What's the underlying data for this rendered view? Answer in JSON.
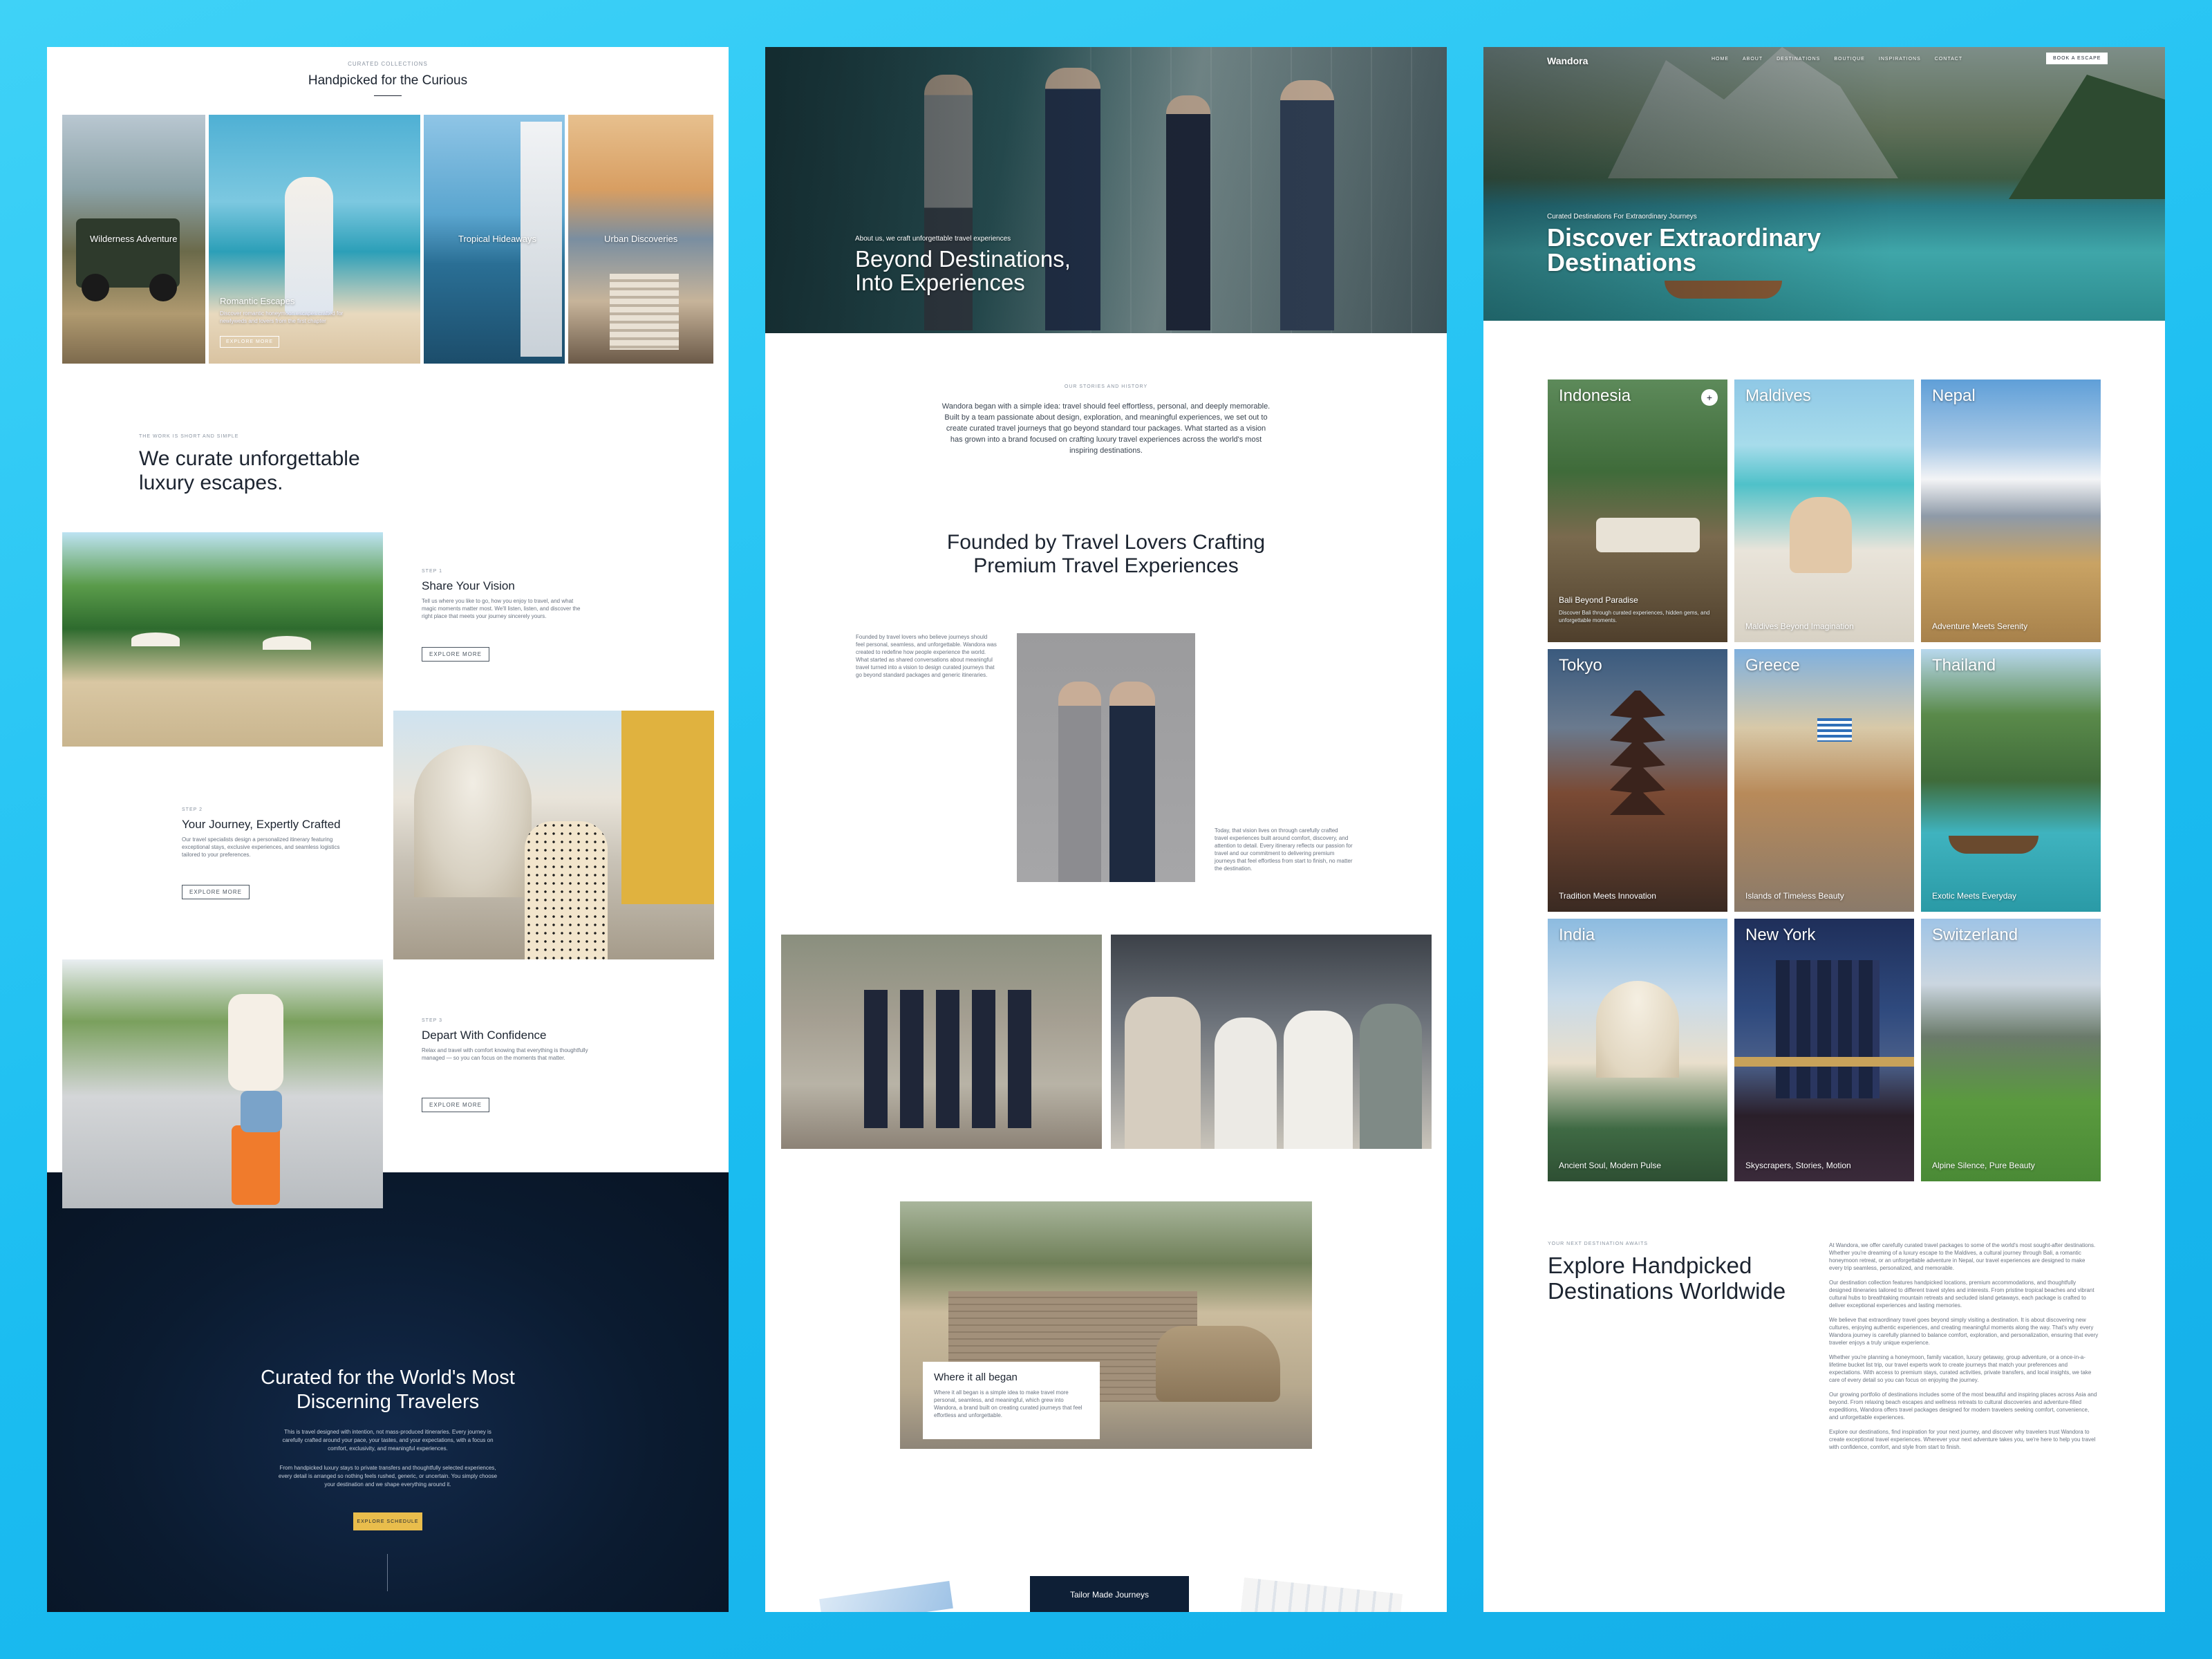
{
  "panel1": {
    "collection_kicker": "CURATED COLLECTIONS",
    "collection_title": "Handpicked for the Curious",
    "cards": [
      {
        "label": "Wilderness Adventure"
      },
      {
        "label": "Romantic Escapes",
        "desc": "Discover romantic honeymoon escapes crafted for newlyweds and lovers from the first chapter",
        "cta": "EXPLORE MORE"
      },
      {
        "label": "Tropical Hideaways"
      },
      {
        "label": "Urban Discoveries"
      }
    ],
    "how_kicker": "THE WORK IS SHORT AND SIMPLE",
    "how_title": "We curate unforgettable luxury escapes.",
    "steps": [
      {
        "step": "STEP 1",
        "title": "Share Your Vision",
        "desc": "Tell us where you like to go, how you enjoy to travel, and what magic moments matter most. We'll listen, listen, and discover the right place that meets your journey sincerely yours.",
        "cta": "EXPLORE MORE"
      },
      {
        "step": "STEP 2",
        "title": "Your Journey, Expertly Crafted",
        "desc": "Our travel specialists design a personalized itinerary featuring exceptional stays, exclusive experiences, and seamless logistics tailored to your preferences.",
        "cta": "EXPLORE MORE"
      },
      {
        "step": "STEP 3",
        "title": "Depart With Confidence",
        "desc": "Relax and travel with comfort knowing that everything is thoughtfully managed — so you can focus on the moments that matter.",
        "cta": "EXPLORE MORE"
      }
    ],
    "dark": {
      "title": "Curated for the World's Most Discerning Travelers",
      "para1": "This is travel designed with intention, not mass-produced itineraries. Every journey is carefully crafted around your pace, your tastes, and your expectations, with a focus on comfort, exclusivity, and meaningful experiences.",
      "para2": "From handpicked luxury stays to private transfers and thoughtfully selected experiences, every detail is arranged so nothing feels rushed, generic, or uncertain. You simply choose your destination and we shape everything around it.",
      "cta": "EXPLORE SCHEDULE"
    }
  },
  "panel2": {
    "hero_kicker": "About us, we craft unforgettable travel experiences",
    "hero_title_1": "Beyond Destinations,",
    "hero_title_2": "Into Experiences",
    "story_kicker": "OUR STORIES AND HISTORY",
    "story_text": "Wandora began with a simple idea: travel should feel effortless, personal, and deeply memorable. Built by a team passionate about design, exploration, and meaningful experiences, we set out to create curated travel journeys that go beyond standard tour packages. What started as a vision has grown into a brand focused on crafting luxury travel experiences across the world's most inspiring destinations.",
    "founded_title_1": "Founded by Travel Lovers Crafting",
    "founded_title_2": "Premium Travel Experiences",
    "founded_left": "Founded by travel lovers who believe journeys should feel personal, seamless, and unforgettable. Wandora was created to redefine how people experience the world. What started as shared conversations about meaningful travel turned into a vision to design curated journeys that go beyond standard packages and generic itineraries.",
    "founded_right": "Today, that vision lives on through carefully crafted travel experiences built around comfort, discovery, and attention to detail. Every itinerary reflects our passion for travel and our commitment to delivering premium journeys that feel effortless from start to finish, no matter the destination.",
    "began_title": "Where it all began",
    "began_text": "Where it all began is a simple idea to make travel more personal, seamless, and meaningful, which grew into Wandora, a brand built on creating curated journeys that feel effortless and unforgettable.",
    "tailor_btn": "Tailor Made Journeys"
  },
  "panel3": {
    "logo": "Wandora",
    "nav": [
      "HOME",
      "ABOUT",
      "DESTINATIONS",
      "BOUTIQUE",
      "INSPIRATIONS",
      "CONTACT"
    ],
    "book_btn": "BOOK A ESCAPE",
    "hero_kicker": "Curated Destinations For Extraordinary Journeys",
    "hero_title_1": "Discover Extraordinary",
    "hero_title_2": "Destinations",
    "destinations": [
      {
        "name": "Indonesia",
        "tagline": "Bali Beyond Paradise",
        "desc": "Discover Bali through curated experiences, hidden gems, and unforgettable moments."
      },
      {
        "name": "Maldives",
        "tagline": "Maldives Beyond Imagination"
      },
      {
        "name": "Nepal",
        "tagline": "Adventure Meets Serenity"
      },
      {
        "name": "Tokyo",
        "tagline": "Tradition Meets Innovation"
      },
      {
        "name": "Greece",
        "tagline": "Islands of Timeless Beauty"
      },
      {
        "name": "Thailand",
        "tagline": "Exotic Meets Everyday"
      },
      {
        "name": "India",
        "tagline": "Ancient Soul, Modern Pulse"
      },
      {
        "name": "New York",
        "tagline": "Skyscrapers, Stories, Motion"
      },
      {
        "name": "Switzerland",
        "tagline": "Alpine Silence, Pure Beauty"
      }
    ],
    "explore_kicker": "YOUR NEXT DESTINATION AWAITS",
    "explore_title_1": "Explore Handpicked",
    "explore_title_2": "Destinations Worldwide",
    "explore_paras": [
      "At Wandora, we offer carefully curated travel packages to some of the world's most sought-after destinations. Whether you're dreaming of a luxury escape to the Maldives, a cultural journey through Bali, a romantic honeymoon retreat, or an unforgettable adventure in Nepal, our travel experiences are designed to make every trip seamless, personalized, and memorable.",
      "Our destination collection features handpicked locations, premium accommodations, and thoughtfully designed itineraries tailored to different travel styles and interests. From pristine tropical beaches and vibrant cultural hubs to breathtaking mountain retreats and secluded island getaways, each package is crafted to deliver exceptional experiences and lasting memories.",
      "We believe that extraordinary travel goes beyond simply visiting a destination. It is about discovering new cultures, enjoying authentic experiences, and creating meaningful moments along the way. That's why every Wandora journey is carefully planned to balance comfort, exploration, and personalization, ensuring that every traveler enjoys a truly unique experience.",
      "Whether you're planning a honeymoon, family vacation, luxury getaway, group adventure, or a once-in-a-lifetime bucket list trip, our travel experts work to create journeys that match your preferences and expectations. With access to premium stays, curated activities, private transfers, and local insights, we take care of every detail so you can focus on enjoying the journey.",
      "Our growing portfolio of destinations includes some of the most beautiful and inspiring places across Asia and beyond. From relaxing beach escapes and wellness retreats to cultural discoveries and adventure-filled expeditions, Wandora offers travel packages designed for modern travelers seeking comfort, convenience, and unforgettable experiences.",
      "Explore our destinations, find inspiration for your next journey, and discover why travelers trust Wandora to create exceptional travel experiences. Wherever your next adventure takes you, we're here to help you travel with confidence, comfort, and style from start to finish."
    ]
  }
}
